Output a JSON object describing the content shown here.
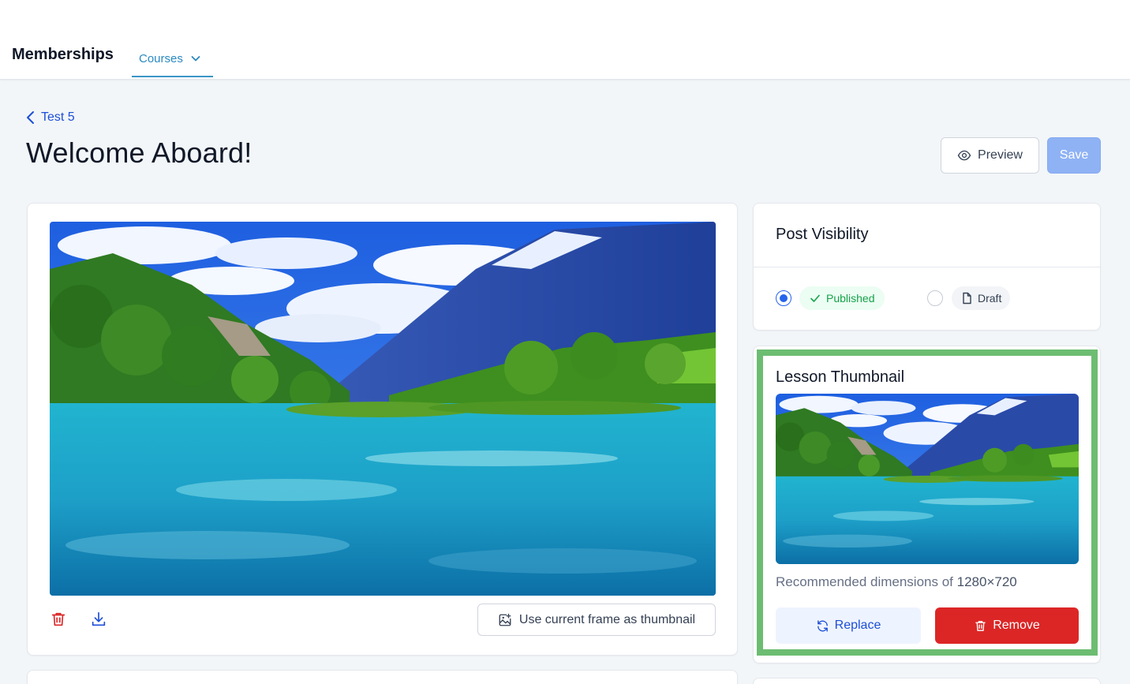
{
  "topbar": {
    "brand": "Memberships",
    "tab_label": "Courses",
    "tab_icon": "chevron-down-icon"
  },
  "header": {
    "breadcrumb": "Test 5",
    "title": "Welcome Aboard!",
    "preview_label": "Preview",
    "save_label": "Save"
  },
  "video": {
    "use_frame_label": "Use current frame as thumbnail",
    "delete_icon": "trash-icon",
    "download_icon": "download-icon"
  },
  "visibility": {
    "title": "Post Visibility",
    "options": [
      {
        "label": "Published",
        "selected": true
      },
      {
        "label": "Draft",
        "selected": false
      }
    ]
  },
  "thumbnail": {
    "title": "Lesson Thumbnail",
    "hint_prefix": "Recommended dimensions of ",
    "hint_value": "1280×720",
    "replace_label": "Replace",
    "remove_label": "Remove"
  },
  "colors": {
    "accent": "#2563eb",
    "danger": "#dc2626",
    "success": "#16a34a",
    "highlight": "#6cbd72",
    "save_disabled": "#8fb2f4"
  }
}
